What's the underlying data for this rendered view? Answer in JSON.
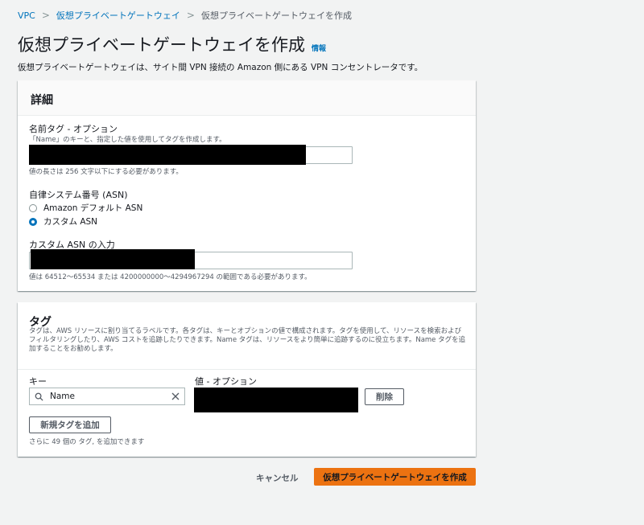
{
  "breadcrumb": {
    "items": [
      "VPC",
      "仮想プライベートゲートウェイ"
    ],
    "current": "仮想プライベートゲートウェイを作成"
  },
  "header": {
    "title": "仮想プライベートゲートウェイを作成",
    "info_label": "情報",
    "description": "仮想プライベートゲートウェイは、サイト間 VPN 接続の Amazon 側にある VPN コンセントレータです。"
  },
  "details": {
    "title": "詳細",
    "name_tag": {
      "label": "名前タグ - オプション",
      "help": "「Name」のキーと、指定した値を使用してタグを作成します。",
      "constraint": "値の長さは 256 文字以下にする必要があります。"
    },
    "asn": {
      "label": "自律システム番号 (ASN)",
      "options": [
        "Amazon デフォルト ASN",
        "カスタム ASN"
      ],
      "selected": "カスタム ASN"
    },
    "custom_asn": {
      "label": "カスタム ASN の入力",
      "constraint": "値は 64512～65534 または 4200000000～4294967294 の範囲である必要があります。"
    }
  },
  "tags": {
    "title": "タグ",
    "description": "タグは、AWS リソースに割り当てるラベルです。各タグは、キーとオプションの値で構成されます。タグを使用して、リソースを検索およびフィルタリングしたり、AWS コストを追跡したりできます。Name タグは、リソースをより簡単に追跡するのに役立ちます。Name タグを追加することをお勧めします。",
    "key_label": "キー",
    "value_label": "値 - オプション",
    "key_value": "Name",
    "remove_label": "削除",
    "add_label": "新規タグを追加",
    "remaining": "さらに 49 個の タグ, を追加できます"
  },
  "footer": {
    "cancel_label": "キャンセル",
    "submit_label": "仮想プライベートゲートウェイを作成"
  },
  "colors": {
    "link": "#0073bb",
    "primary": "#ec7211",
    "background": "#f2f3f3"
  }
}
